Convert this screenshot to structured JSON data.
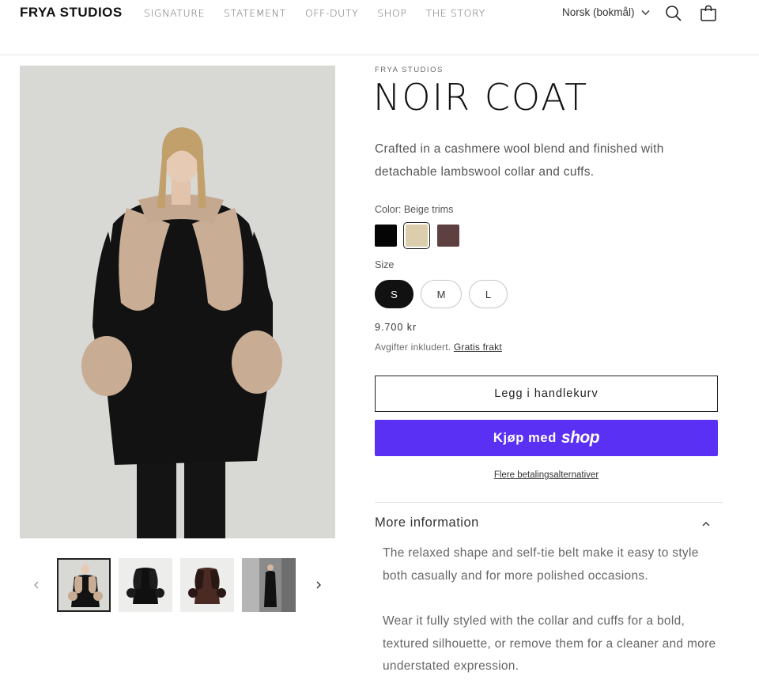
{
  "header": {
    "logo": "FRYA STUDIOS",
    "nav": [
      "SIGNATURE",
      "STATEMENT",
      "OFF-DUTY",
      "SHOP",
      "THE STORY"
    ],
    "language": "Norsk (bokmål)",
    "icons": {
      "search": "search-icon",
      "cart": "cart-icon",
      "language": "chevron-down-icon"
    }
  },
  "product": {
    "vendor": "FRYA STUDIOS",
    "title": "NOIR COAT",
    "description": "Crafted in a cashmere wool blend and finished with detachable lambswool collar and cuffs.",
    "color_label": "Color: Beige trims",
    "colors": [
      {
        "name": "Black",
        "hex": "#050505"
      },
      {
        "name": "Beige trims",
        "hex": "#dcceac",
        "selected": true
      },
      {
        "name": "Brown",
        "hex": "#5e4040"
      }
    ],
    "size_label": "Size",
    "sizes": [
      "S",
      "M",
      "L"
    ],
    "selected_size": "S",
    "price": "9.700 kr",
    "tax_text": "Avgifter inkludert.",
    "shipping_link": "Gratis frakt",
    "add_to_cart": "Legg i handlekurv",
    "buy_now_prefix": "Kjøp med",
    "buy_now_brand": "shop",
    "more_payment": "Flere betalingsalternativer",
    "more_info_title": "More information",
    "more_info_paragraphs": [
      "The relaxed shape and self-tie belt make it easy to style both casually and for more polished occasions.",
      "Wear it fully styled with the collar and cuffs for a bold, textured silhouette, or remove them for a cleaner and more understated expression."
    ]
  },
  "gallery": {
    "thumbnails": [
      "coat-beige-front",
      "coat-black-front",
      "coat-brown-front",
      "coat-lifestyle"
    ],
    "active_index": 0
  },
  "colors": {
    "accent_shop": "#5a31f4",
    "text": "#1a1a1a",
    "muted": "#6b6b6b"
  }
}
